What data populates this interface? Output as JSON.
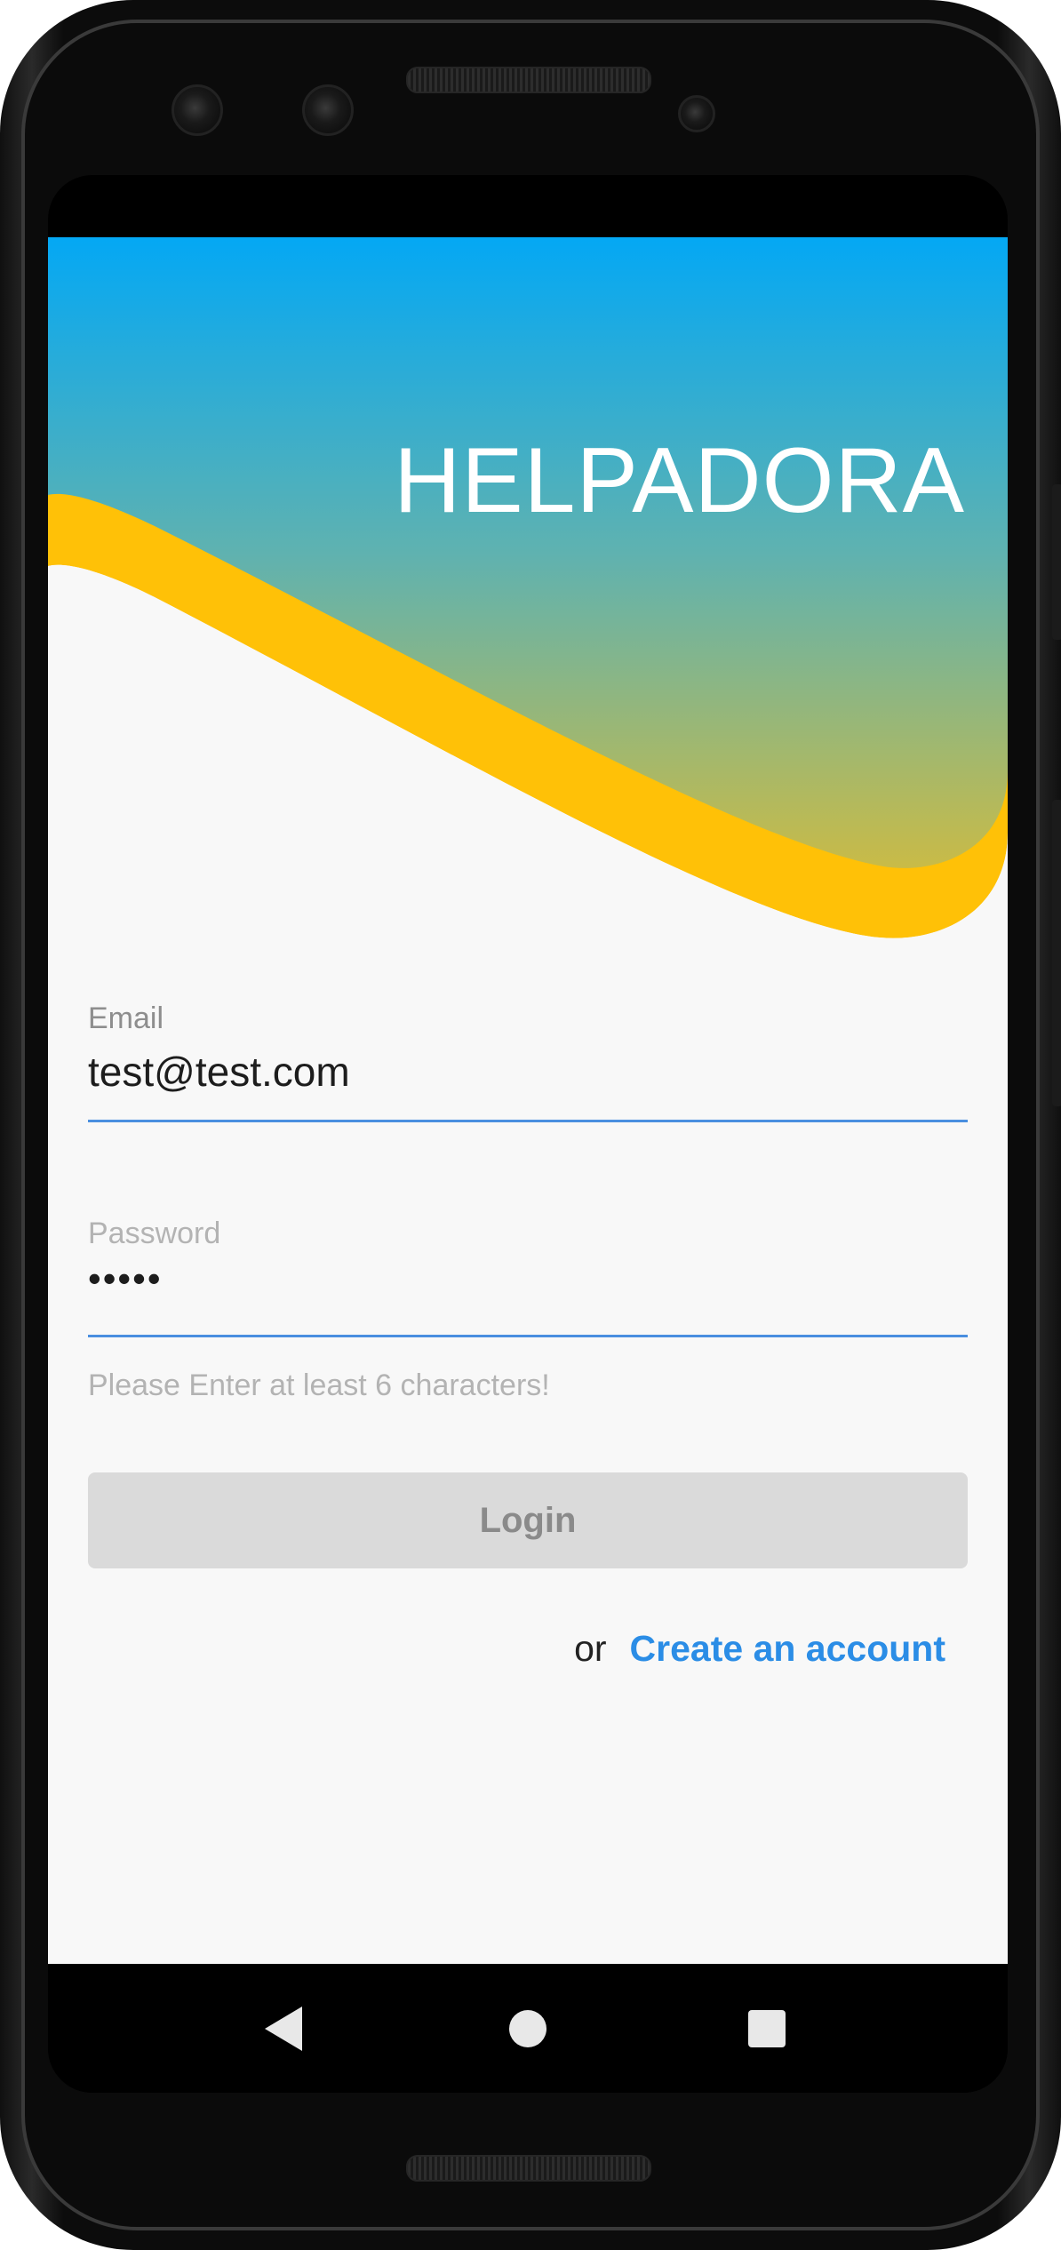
{
  "app": {
    "title": "HELPADORA"
  },
  "email_field": {
    "label": "Email",
    "value": "test@test.com"
  },
  "password_field": {
    "label": "Password",
    "value": "•••••",
    "helper": "Please Enter at least 6 characters!"
  },
  "login_button": {
    "label": "Login"
  },
  "signup": {
    "prefix": "or",
    "link_label": "Create an account"
  },
  "nav_bar": {
    "icons": [
      "back-icon",
      "home-icon",
      "recents-icon"
    ]
  },
  "colors": {
    "gradient_top": "#04a8f4",
    "gradient_bottom": "#c9bb47",
    "wave_accent": "#ffc107",
    "focus_underline": "#4a8fe0",
    "link": "#2b8de6"
  }
}
